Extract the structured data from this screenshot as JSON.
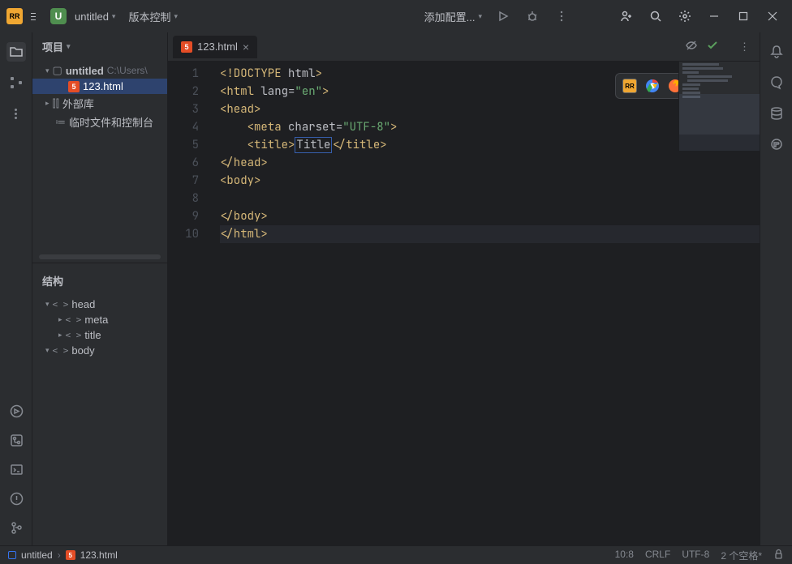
{
  "titlebar": {
    "project_badge": "U",
    "project_name": "untitled",
    "vcs_label": "版本控制",
    "run_config": "添加配置..."
  },
  "sidebar": {
    "panel_title": "项目",
    "root_name": "untitled",
    "root_path": "C:\\Users\\",
    "file_name": "123.html",
    "external_libs": "外部库",
    "scratches": "临时文件和控制台",
    "structure_title": "结构",
    "structure": {
      "head": "head",
      "meta": "meta",
      "title": "title",
      "body": "body"
    }
  },
  "tabs": {
    "active": "123.html"
  },
  "editor": {
    "lines": [
      {
        "n": "1",
        "segs": [
          {
            "t": "<!DOCTYPE ",
            "c": "t-doctype"
          },
          {
            "t": "html",
            "c": "t-attr"
          },
          {
            "t": ">",
            "c": "t-doctype"
          }
        ]
      },
      {
        "n": "2",
        "segs": [
          {
            "t": "<html ",
            "c": "t-tag"
          },
          {
            "t": "lang",
            "c": "t-attr"
          },
          {
            "t": "=",
            "c": "t-attr"
          },
          {
            "t": "\"en\"",
            "c": "t-str"
          },
          {
            "t": ">",
            "c": "t-tag"
          }
        ]
      },
      {
        "n": "3",
        "segs": [
          {
            "t": "<head>",
            "c": "t-tag"
          }
        ]
      },
      {
        "n": "4",
        "segs": [
          {
            "t": "    ",
            "c": "t-text"
          },
          {
            "t": "<meta ",
            "c": "t-tag"
          },
          {
            "t": "charset",
            "c": "t-attr"
          },
          {
            "t": "=",
            "c": "t-attr"
          },
          {
            "t": "\"UTF-8\"",
            "c": "t-str"
          },
          {
            "t": ">",
            "c": "t-tag"
          }
        ]
      },
      {
        "n": "5",
        "segs": [
          {
            "t": "    ",
            "c": "t-text"
          },
          {
            "t": "<title>",
            "c": "t-tag"
          },
          {
            "t": "Title",
            "c": "t-text",
            "box": true
          },
          {
            "t": "</title>",
            "c": "t-tag"
          }
        ]
      },
      {
        "n": "6",
        "segs": [
          {
            "t": "</head>",
            "c": "t-tag"
          }
        ]
      },
      {
        "n": "7",
        "segs": [
          {
            "t": "<body>",
            "c": "t-tag"
          }
        ]
      },
      {
        "n": "8",
        "segs": []
      },
      {
        "n": "9",
        "segs": [
          {
            "t": "</body>",
            "c": "t-tag"
          }
        ]
      },
      {
        "n": "10",
        "segs": [
          {
            "t": "</html>",
            "c": "t-tag"
          }
        ],
        "current": true
      }
    ]
  },
  "statusbar": {
    "crumb_project": "untitled",
    "crumb_file": "123.html",
    "position": "10:8",
    "line_sep": "CRLF",
    "encoding": "UTF-8",
    "indent": "2 个空格*"
  }
}
